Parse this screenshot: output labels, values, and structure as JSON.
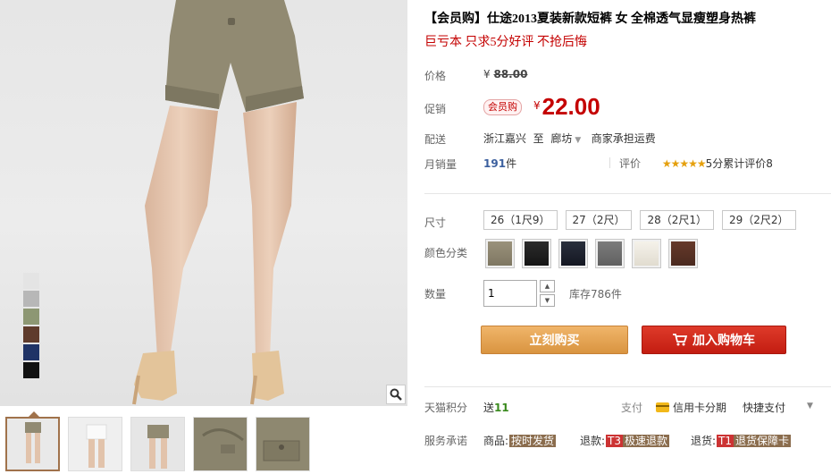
{
  "product": {
    "title": "【会员购】仕途2013夏装新款短裤 女 全棉透气显瘦塑身热裤",
    "subtitle": "巨亏本 只求5分好评 不抢后悔"
  },
  "price": {
    "label": "价格",
    "currency": "¥",
    "original": "88.00"
  },
  "promo": {
    "label": "促销",
    "tag": "会员购",
    "currency": "¥",
    "price": "22.00"
  },
  "shipping": {
    "label": "配送",
    "from": "浙江嘉兴",
    "to_word": "至",
    "destination": "廊坊",
    "fee_note": "商家承担运费"
  },
  "sales": {
    "label": "月销量",
    "count": "191",
    "unit": "件"
  },
  "review": {
    "label": "评价",
    "stars": "★★★★★",
    "score": "5分",
    "total_label": "累计评价",
    "total": "8"
  },
  "size": {
    "label": "尺寸",
    "options": [
      "26（1尺9）",
      "27（2尺）",
      "28（2尺1）",
      "29（2尺2）"
    ]
  },
  "color": {
    "label": "颜色分类",
    "swatches": [
      "#8e8670",
      "#1f1f1f",
      "#1b1f2b",
      "#6f6f6f",
      "#ece7dc",
      "#5a3426"
    ]
  },
  "quantity": {
    "label": "数量",
    "value": "1",
    "stock": "库存786件"
  },
  "actions": {
    "buy": "立刻购买",
    "cart": "加入购物车"
  },
  "tmall_points": {
    "label": "天猫积分",
    "prefix": "送",
    "value": "11"
  },
  "payment": {
    "label": "支付",
    "credit": "信用卡分期",
    "quick": "快捷支付"
  },
  "service": {
    "label": "服务承诺",
    "item1_prefix": "商品:",
    "item1_tag": "按时发货",
    "item2_prefix": "退款:",
    "item2_badge": "T3",
    "item2_tag": "极速退款",
    "item3_prefix": "退货:",
    "item3_badge": "T1",
    "item3_tag": "退货保障卡"
  },
  "gallery": {
    "color_strip": [
      "#e4e4e4",
      "#b7b7b7",
      "#8d9773",
      "#5f3b2c",
      "#1f3366",
      "#111111"
    ],
    "thumb_count": 5
  }
}
